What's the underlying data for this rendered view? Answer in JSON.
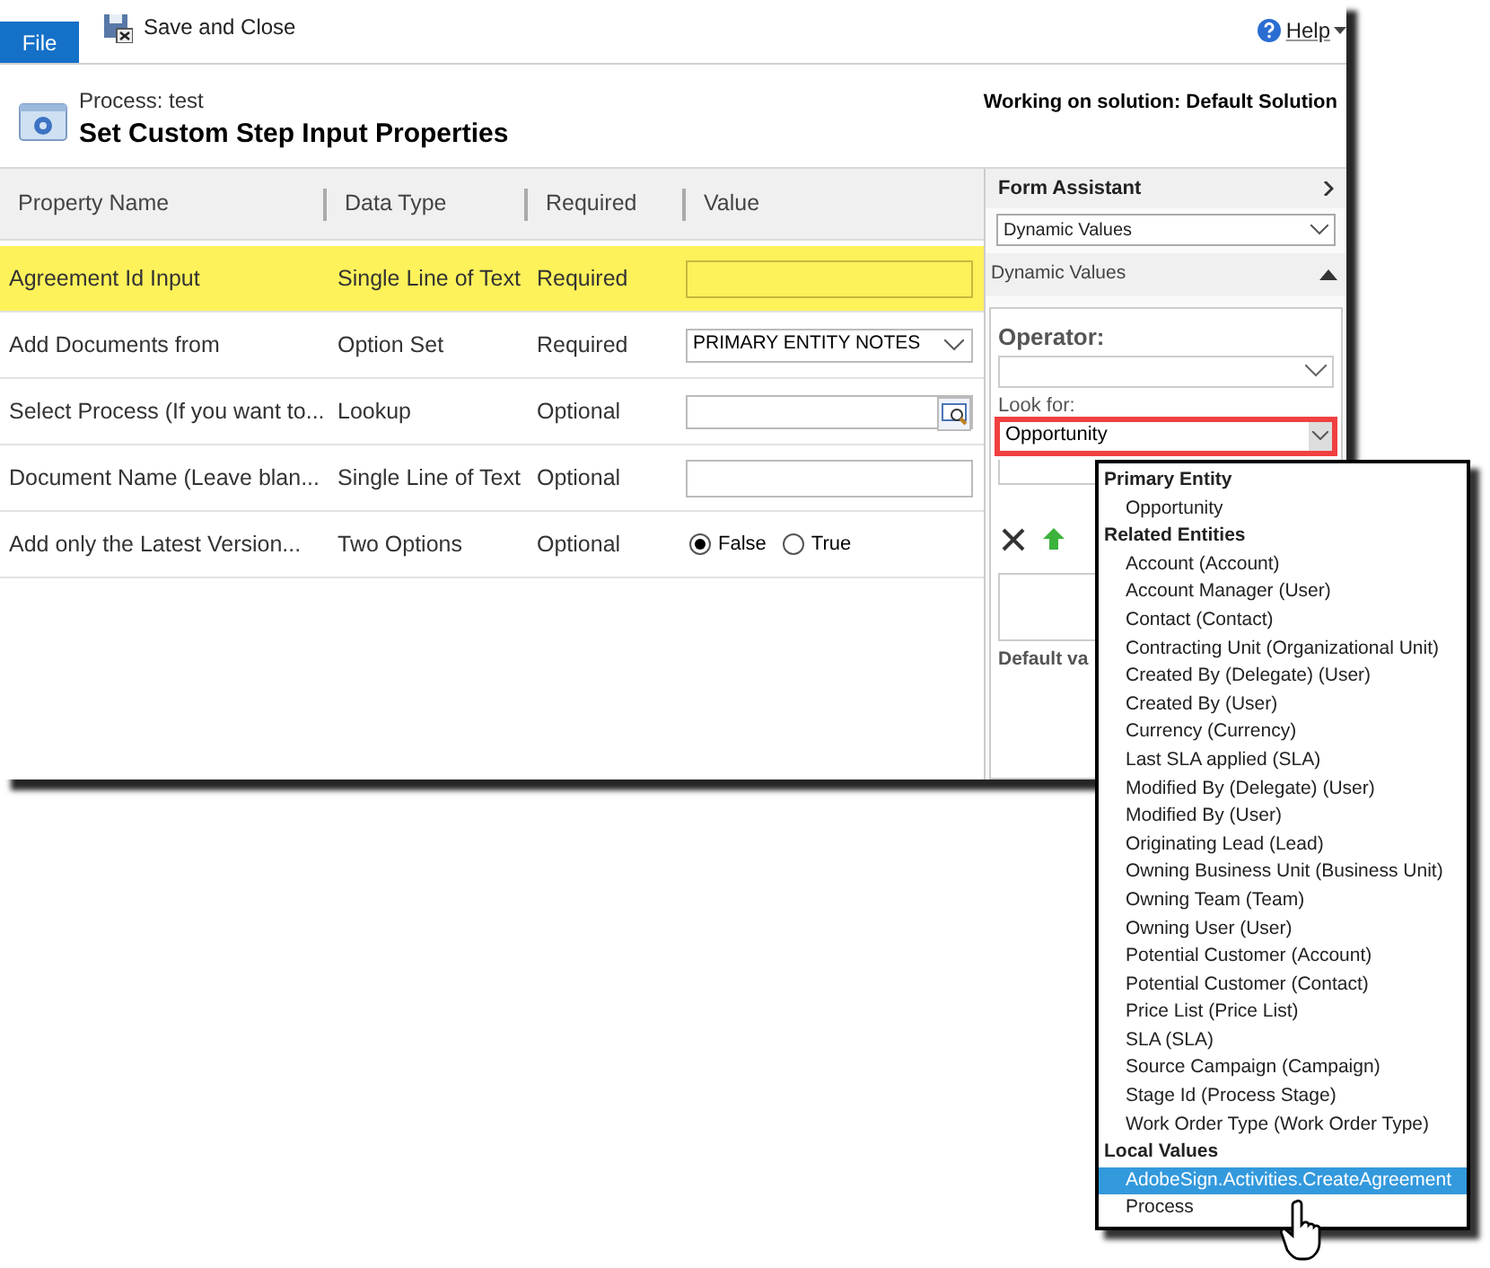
{
  "ribbon": {
    "file_tab": "File",
    "save_close": "Save and Close",
    "help": "Help"
  },
  "header": {
    "subtitle": "Process: test",
    "title": "Set Custom Step Input Properties",
    "solution": "Working on solution: Default Solution"
  },
  "table": {
    "columns": [
      "Property Name",
      "Data Type",
      "Required",
      "Value"
    ],
    "rows": [
      {
        "name": "Agreement Id Input",
        "type": "Single Line of Text",
        "required": "Required",
        "selected": true,
        "kind": "text"
      },
      {
        "name": "Add Documents from",
        "type": "Option Set",
        "required": "Required",
        "selected": false,
        "kind": "select",
        "value": "PRIMARY ENTITY NOTES"
      },
      {
        "name": "Select Process (If you want to...",
        "type": "Lookup",
        "required": "Optional",
        "selected": false,
        "kind": "lookup"
      },
      {
        "name": "Document Name (Leave blan...",
        "type": "Single Line of Text",
        "required": "Optional",
        "selected": false,
        "kind": "text"
      },
      {
        "name": "Add only the Latest Version...",
        "type": "Two Options",
        "required": "Optional",
        "selected": false,
        "kind": "radio",
        "options": [
          {
            "label": "False",
            "selected": true
          },
          {
            "label": "True",
            "selected": false
          }
        ]
      }
    ]
  },
  "form_assistant": {
    "title": "Form Assistant",
    "mode": "Dynamic Values",
    "section": {
      "title": "Dynamic Values",
      "expanded": true
    },
    "operator_label": "Operator:",
    "look_for_label": "Look for:",
    "look_for_value": "Opportunity",
    "default_label": "Default va"
  },
  "dropdown": {
    "groups": [
      {
        "label": "Primary Entity",
        "items": [
          {
            "label": "Opportunity",
            "selected": false
          }
        ]
      },
      {
        "label": "Related Entities",
        "items": [
          {
            "label": "Account (Account)",
            "selected": false
          },
          {
            "label": "Account Manager (User)",
            "selected": false
          },
          {
            "label": "Contact (Contact)",
            "selected": false
          },
          {
            "label": "Contracting Unit (Organizational Unit)",
            "selected": false
          },
          {
            "label": "Created By (Delegate) (User)",
            "selected": false
          },
          {
            "label": "Created By (User)",
            "selected": false
          },
          {
            "label": "Currency (Currency)",
            "selected": false
          },
          {
            "label": "Last SLA applied (SLA)",
            "selected": false
          },
          {
            "label": "Modified By (Delegate) (User)",
            "selected": false
          },
          {
            "label": "Modified By (User)",
            "selected": false
          },
          {
            "label": "Originating Lead (Lead)",
            "selected": false
          },
          {
            "label": "Owning Business Unit (Business Unit)",
            "selected": false
          },
          {
            "label": "Owning Team (Team)",
            "selected": false
          },
          {
            "label": "Owning User (User)",
            "selected": false
          },
          {
            "label": "Potential Customer (Account)",
            "selected": false
          },
          {
            "label": "Potential Customer (Contact)",
            "selected": false
          },
          {
            "label": "Price List (Price List)",
            "selected": false
          },
          {
            "label": "SLA (SLA)",
            "selected": false
          },
          {
            "label": "Source Campaign (Campaign)",
            "selected": false
          },
          {
            "label": "Stage Id (Process Stage)",
            "selected": false
          },
          {
            "label": "Work Order Type (Work Order Type)",
            "selected": false
          }
        ]
      },
      {
        "label": "Local Values",
        "items": [
          {
            "label": "AdobeSign.Activities.CreateAgreement",
            "selected": true
          },
          {
            "label": "Process",
            "selected": false
          }
        ]
      }
    ]
  }
}
